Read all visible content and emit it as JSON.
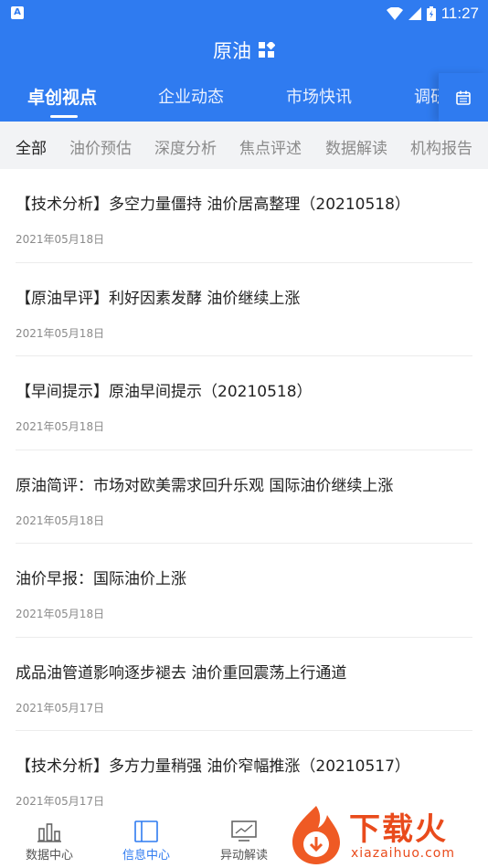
{
  "status_bar": {
    "time": "11:27",
    "notification_icon": "A"
  },
  "header": {
    "title": "原油",
    "title_icon": "grid-icon"
  },
  "tabs": [
    {
      "label": "卓创视点",
      "active": true
    },
    {
      "label": "企业动态",
      "active": false
    },
    {
      "label": "市场快讯",
      "active": false
    },
    {
      "label": "调研",
      "active": false
    }
  ],
  "subtabs": [
    {
      "label": "全部",
      "active": true
    },
    {
      "label": "油价预估",
      "active": false
    },
    {
      "label": "深度分析",
      "active": false
    },
    {
      "label": "焦点评述",
      "active": false
    },
    {
      "label": "数据解读",
      "active": false
    },
    {
      "label": "机构报告",
      "active": false
    }
  ],
  "articles": [
    {
      "title": "【技术分析】多空力量僵持 油价居高整理（20210518）",
      "date": "2021年05月18日"
    },
    {
      "title": "【原油早评】利好因素发酵  油价继续上涨",
      "date": "2021年05月18日"
    },
    {
      "title": "【早间提示】原油早间提示（20210518）",
      "date": "2021年05月18日"
    },
    {
      "title": "原油简评：市场对欧美需求回升乐观 国际油价继续上涨",
      "date": "2021年05月18日"
    },
    {
      "title": "油价早报：国际油价上涨",
      "date": "2021年05月18日"
    },
    {
      "title": "成品油管道影响逐步褪去 油价重回震荡上行通道",
      "date": "2021年05月17日"
    },
    {
      "title": "【技术分析】多方力量稍强 油价窄幅推涨（20210517）",
      "date": "2021年05月17日"
    }
  ],
  "bottom_nav": [
    {
      "label": "数据中心",
      "icon": "bar-chart-icon",
      "active": false
    },
    {
      "label": "信息中心",
      "icon": "tablet-icon",
      "active": true
    },
    {
      "label": "异动解读",
      "icon": "monitor-chart-icon",
      "active": false
    }
  ],
  "watermark": {
    "text": "下载火",
    "url": "xiazaihuo.com"
  },
  "colors": {
    "primary": "#2f7bf0",
    "watermark": "#e94b1c"
  }
}
